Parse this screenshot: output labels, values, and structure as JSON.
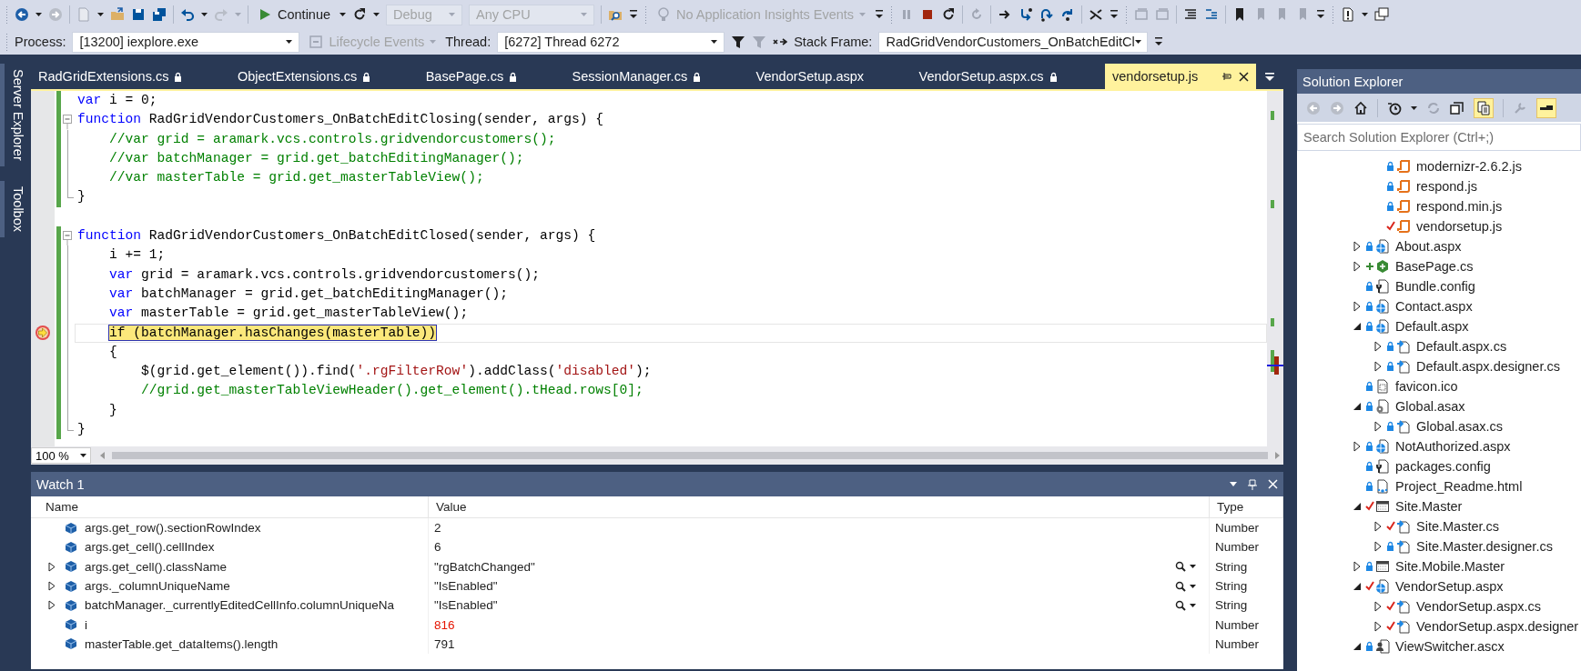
{
  "toolbar": {
    "continue": "Continue",
    "configuration": {
      "value": "Debug",
      "disabled": true
    },
    "platform": {
      "value": "Any CPU",
      "disabled": true
    },
    "insights": {
      "label": "No Application Insights Events",
      "disabled": true
    }
  },
  "debug_location": {
    "process_label": "Process:",
    "process": "[13200] iexplore.exe",
    "lifecycle": {
      "label": "Lifecycle Events",
      "disabled": true
    },
    "thread_label": "Thread:",
    "thread": "[6272] Thread 6272",
    "stack_frame_label": "Stack Frame:",
    "stack_frame": "RadGridVendorCustomers_OnBatchEditCl"
  },
  "side_tabs": [
    "Server Explorer",
    "Toolbox"
  ],
  "tabs": [
    {
      "label": "RadGridExtensions.cs",
      "locked": true,
      "selected": false
    },
    {
      "label": "ObjectExtensions.cs",
      "locked": true,
      "selected": false
    },
    {
      "label": "BasePage.cs",
      "locked": true,
      "selected": false
    },
    {
      "label": "SessionManager.cs",
      "locked": true,
      "selected": false
    },
    {
      "label": "VendorSetup.aspx",
      "locked": false,
      "selected": false
    },
    {
      "label": "VendorSetup.aspx.cs",
      "locked": true,
      "selected": false
    },
    {
      "label": "vendorsetup.js",
      "locked": false,
      "selected": true
    }
  ],
  "editor": {
    "zoom": "100 %",
    "lines": [
      {
        "modified": true,
        "collapsible": false,
        "block_end": false,
        "current": false,
        "tokens": [
          {
            "kind": "keyword",
            "text": "var"
          },
          {
            "kind": "plain",
            "text": " i = 0;"
          }
        ]
      },
      {
        "modified": true,
        "collapsible": true,
        "block_end": false,
        "current": false,
        "tokens": [
          {
            "kind": "keyword",
            "text": "function"
          },
          {
            "kind": "plain",
            "text": " RadGridVendorCustomers_OnBatchEditClosing(sender, args) {"
          }
        ]
      },
      {
        "modified": true,
        "collapsible": false,
        "block_end": false,
        "current": false,
        "tokens": [
          {
            "kind": "comment",
            "text": "    //var grid = aramark.vcs.controls.gridvendorcustomers();"
          }
        ]
      },
      {
        "modified": true,
        "collapsible": false,
        "block_end": false,
        "current": false,
        "tokens": [
          {
            "kind": "comment",
            "text": "    //var batchManager = grid.get_batchEditingManager();"
          }
        ]
      },
      {
        "modified": true,
        "collapsible": false,
        "block_end": false,
        "current": false,
        "tokens": [
          {
            "kind": "comment",
            "text": "    //var masterTable = grid.get_masterTableView();"
          }
        ]
      },
      {
        "modified": true,
        "collapsible": false,
        "block_end": true,
        "current": false,
        "tokens": [
          {
            "kind": "plain",
            "text": "}"
          }
        ]
      },
      {
        "modified": false,
        "collapsible": false,
        "block_end": false,
        "current": false
      },
      {
        "modified": true,
        "collapsible": true,
        "block_end": false,
        "current": false,
        "tokens": [
          {
            "kind": "keyword",
            "text": "function"
          },
          {
            "kind": "plain",
            "text": " RadGridVendorCustomers_OnBatchEditClosed(sender, args) {"
          }
        ]
      },
      {
        "modified": true,
        "collapsible": false,
        "block_end": false,
        "current": false,
        "tokens": [
          {
            "kind": "plain",
            "text": "    i += 1;"
          }
        ]
      },
      {
        "modified": true,
        "collapsible": false,
        "block_end": false,
        "current": false,
        "tokens": [
          {
            "kind": "keyword",
            "text": "    var"
          },
          {
            "kind": "plain",
            "text": " grid = aramark.vcs.controls.gridvendorcustomers();"
          }
        ]
      },
      {
        "modified": true,
        "collapsible": false,
        "block_end": false,
        "current": false,
        "tokens": [
          {
            "kind": "keyword",
            "text": "    var"
          },
          {
            "kind": "plain",
            "text": " batchManager = grid.get_batchEditingManager();"
          }
        ]
      },
      {
        "modified": true,
        "collapsible": false,
        "block_end": false,
        "current": false,
        "tokens": [
          {
            "kind": "keyword",
            "text": "    var"
          },
          {
            "kind": "plain",
            "text": " masterTable = grid.get_masterTableView();"
          }
        ]
      },
      {
        "modified": true,
        "collapsible": false,
        "block_end": false,
        "current": true,
        "tokens": [
          {
            "kind": "plain",
            "text": "    if (batchManager.hasChanges(masterTable))"
          }
        ]
      },
      {
        "modified": true,
        "collapsible": false,
        "block_end": false,
        "current": false,
        "tokens": [
          {
            "kind": "plain",
            "text": "    {"
          }
        ]
      },
      {
        "modified": true,
        "collapsible": false,
        "block_end": false,
        "current": false,
        "tokens": [
          {
            "kind": "plain",
            "text": "        $(grid.get_element()).find("
          },
          {
            "kind": "string",
            "text": "'.rgFilterRow'"
          },
          {
            "kind": "plain",
            "text": ").addClass("
          },
          {
            "kind": "string",
            "text": "'disabled'"
          },
          {
            "kind": "plain",
            "text": ");"
          }
        ]
      },
      {
        "modified": true,
        "collapsible": false,
        "block_end": false,
        "current": false,
        "tokens": [
          {
            "kind": "comment",
            "text": "        //grid.get_masterTableViewHeader().get_element().tHead.rows[0];"
          }
        ]
      },
      {
        "modified": true,
        "collapsible": false,
        "block_end": false,
        "current": false,
        "tokens": [
          {
            "kind": "plain",
            "text": "    }"
          }
        ]
      },
      {
        "modified": true,
        "collapsible": false,
        "block_end": true,
        "current": false,
        "tokens": [
          {
            "kind": "plain",
            "text": "}"
          }
        ]
      }
    ]
  },
  "watch": {
    "title": "Watch 1",
    "columns": [
      "Name",
      "Value",
      "Type"
    ],
    "rows": [
      {
        "name": "args.get_row().sectionRowIndex",
        "value": "2",
        "type": "Number",
        "expandable": false,
        "visualizer": false,
        "changed": false
      },
      {
        "name": "args.get_cell().cellIndex",
        "value": "6",
        "type": "Number",
        "expandable": false,
        "visualizer": false,
        "changed": false
      },
      {
        "name": "args.get_cell().className",
        "value": "\"rgBatchChanged\"",
        "type": "String",
        "expandable": true,
        "visualizer": true,
        "changed": false
      },
      {
        "name": "args._columnUniqueName",
        "value": "\"IsEnabled\"",
        "type": "String",
        "expandable": true,
        "visualizer": true,
        "changed": false
      },
      {
        "name": "batchManager._currentlyEditedCellInfo.columnUniqueNa",
        "value": "\"IsEnabled\"",
        "type": "String",
        "expandable": true,
        "visualizer": true,
        "changed": false
      },
      {
        "name": "i",
        "value": "816",
        "type": "Number",
        "expandable": false,
        "visualizer": false,
        "changed": true
      },
      {
        "name": "masterTable.get_dataItems().length",
        "value": "791",
        "type": "Number",
        "expandable": false,
        "visualizer": false,
        "changed": false
      }
    ]
  },
  "solution_explorer": {
    "title": "Solution Explorer",
    "show_all_files": true,
    "preview": true,
    "search_placeholder": "Search Solution Explorer (Ctrl+;)",
    "tree": [
      {
        "children": [
          {
            "label": "modernizr-2.6.2.js",
            "kind": "script",
            "checked_out": false,
            "added": false
          },
          {
            "label": "respond.js",
            "kind": "script",
            "checked_out": false,
            "added": false
          },
          {
            "label": "respond.min.js",
            "kind": "script",
            "checked_out": false,
            "added": false
          },
          {
            "label": "vendorsetup.js",
            "kind": "script",
            "checked_out": true,
            "added": false
          }
        ]
      },
      {
        "label": "About.aspx",
        "kind": "web",
        "checked_out": false,
        "added": false,
        "expanded": false
      },
      {
        "label": "BasePage.cs",
        "kind": "csharp",
        "checked_out": false,
        "added": true,
        "expanded": false
      },
      {
        "label": "Bundle.config",
        "kind": "config",
        "checked_out": false,
        "added": false
      },
      {
        "label": "Contact.aspx",
        "kind": "web",
        "checked_out": false,
        "added": false,
        "expanded": false
      },
      {
        "label": "Default.aspx",
        "kind": "web",
        "checked_out": false,
        "added": false,
        "expanded": true,
        "children": [
          {
            "label": "Default.aspx.cs",
            "kind": "code",
            "checked_out": false,
            "added": false,
            "expanded": false
          },
          {
            "label": "Default.aspx.designer.cs",
            "kind": "code",
            "checked_out": false,
            "added": false,
            "expanded": false
          }
        ]
      },
      {
        "label": "favicon.ico",
        "kind": "image",
        "checked_out": false,
        "added": false
      },
      {
        "label": "Global.asax",
        "kind": "gear",
        "checked_out": false,
        "added": false,
        "expanded": true,
        "children": [
          {
            "label": "Global.asax.cs",
            "kind": "code",
            "checked_out": false,
            "added": false,
            "expanded": false
          }
        ]
      },
      {
        "label": "NotAuthorized.aspx",
        "kind": "web",
        "checked_out": false,
        "added": false,
        "expanded": false
      },
      {
        "label": "packages.config",
        "kind": "config",
        "checked_out": false,
        "added": false
      },
      {
        "label": "Project_Readme.html",
        "kind": "html",
        "checked_out": false,
        "added": false
      },
      {
        "label": "Site.Master",
        "kind": "master",
        "checked_out": true,
        "added": false,
        "expanded": true,
        "children": [
          {
            "label": "Site.Master.cs",
            "kind": "code",
            "checked_out": true,
            "added": false,
            "expanded": false
          },
          {
            "label": "Site.Master.designer.cs",
            "kind": "code",
            "checked_out": false,
            "added": false,
            "expanded": false
          }
        ]
      },
      {
        "label": "Site.Mobile.Master",
        "kind": "master",
        "checked_out": false,
        "added": false,
        "expanded": false
      },
      {
        "label": "VendorSetup.aspx",
        "kind": "web",
        "checked_out": true,
        "added": false,
        "expanded": true,
        "children": [
          {
            "label": "VendorSetup.aspx.cs",
            "kind": "code",
            "checked_out": true,
            "added": false,
            "expanded": false
          },
          {
            "label": "VendorSetup.aspx.designer",
            "kind": "code",
            "checked_out": true,
            "added": false,
            "expanded": false
          }
        ]
      },
      {
        "label": "ViewSwitcher.ascx",
        "kind": "user-control",
        "checked_out": false,
        "added": false,
        "expanded": true
      }
    ]
  }
}
